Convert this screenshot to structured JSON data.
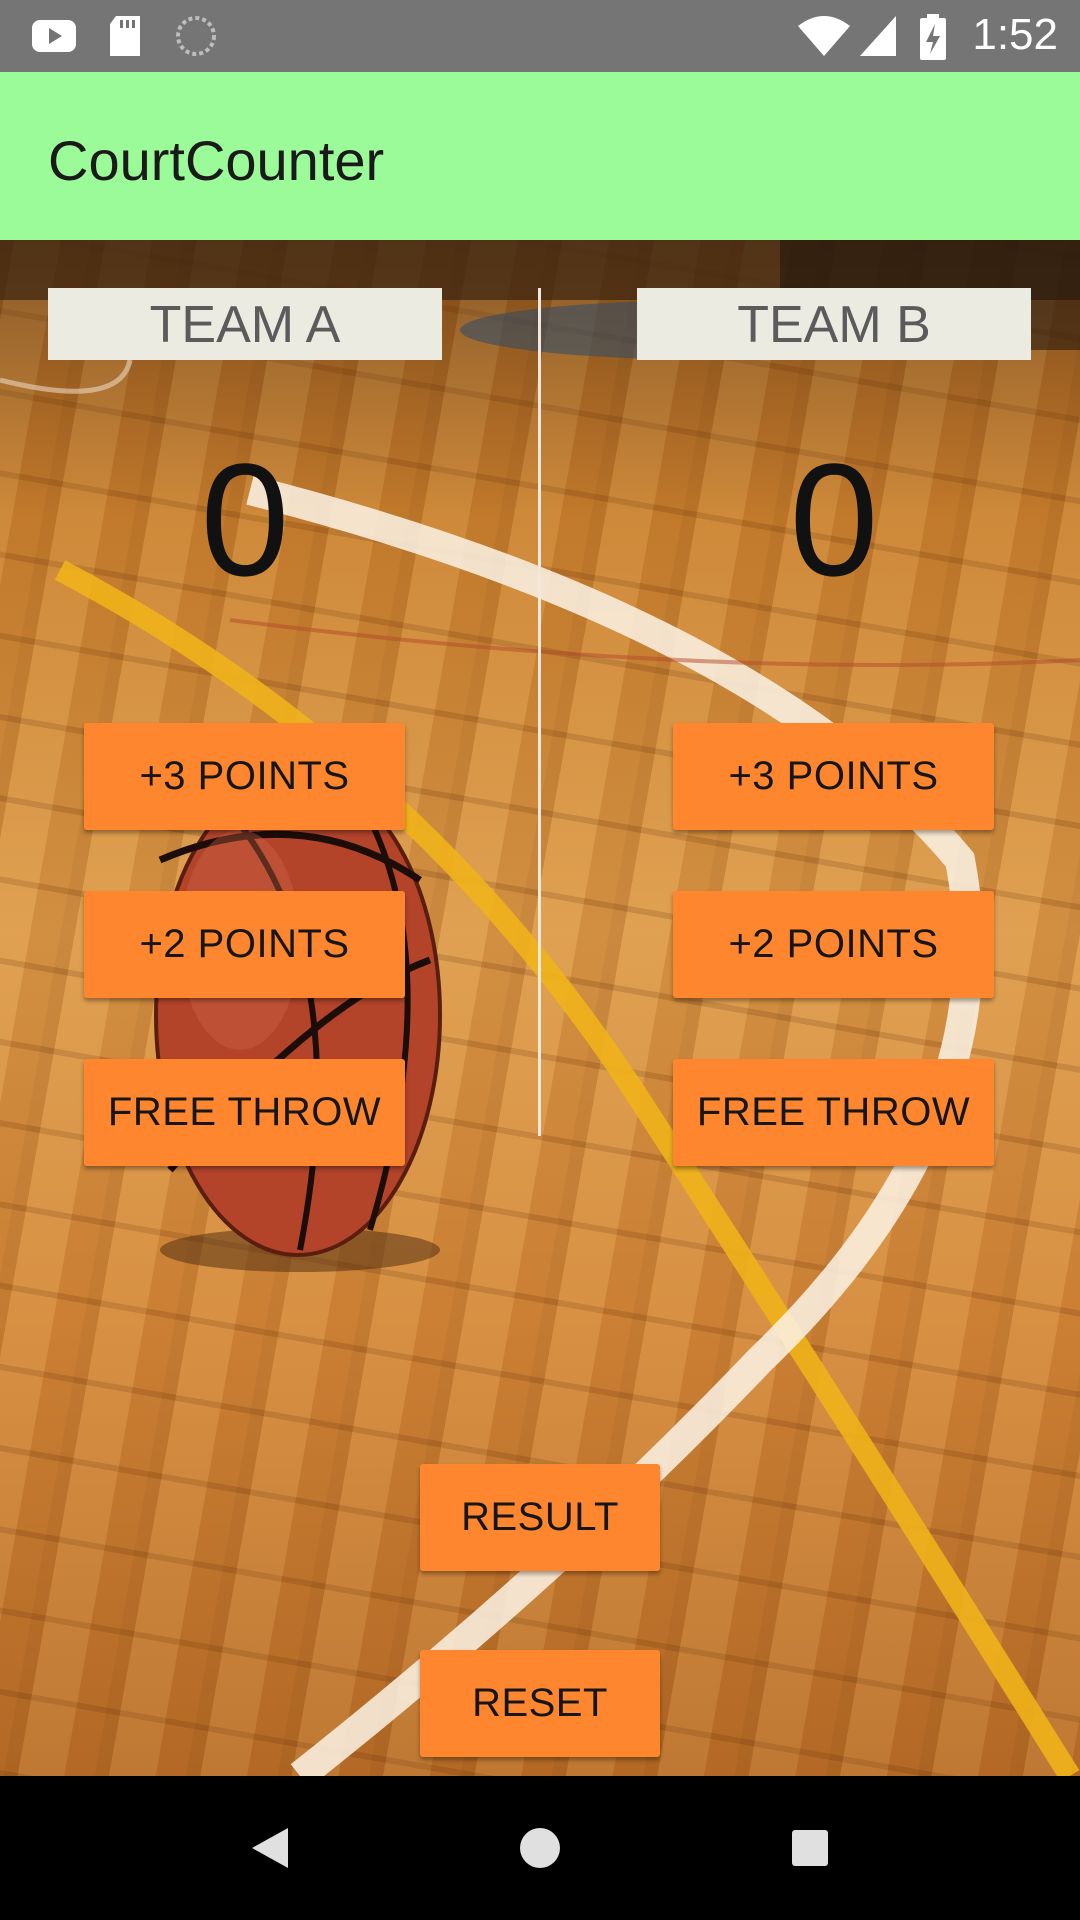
{
  "status_bar": {
    "time": "1:52",
    "left_icons": [
      "youtube-icon",
      "sd-card-icon",
      "loading-icon"
    ],
    "right_icons": [
      "wifi-icon",
      "signal-icon",
      "battery-charging-icon"
    ]
  },
  "app_bar": {
    "title": "CourtCounter"
  },
  "team_a": {
    "label": "TEAM A",
    "score": "0",
    "buttons": {
      "three": "+3 POINTS",
      "two": "+2 POINTS",
      "free_throw": "FREE THROW"
    }
  },
  "team_b": {
    "label": "TEAM B",
    "score": "0",
    "buttons": {
      "three": "+3 POINTS",
      "two": "+2 POINTS",
      "free_throw": "FREE THROW"
    }
  },
  "actions": {
    "result": "RESULT",
    "reset": "RESET"
  },
  "nav_bar": {
    "icons": [
      "back-icon",
      "home-icon",
      "recents-icon"
    ]
  },
  "colors": {
    "status_bar": "#757575",
    "app_bar": "#9bfb98",
    "button": "#fe862f",
    "team_label_bg": "#ebebe2"
  }
}
